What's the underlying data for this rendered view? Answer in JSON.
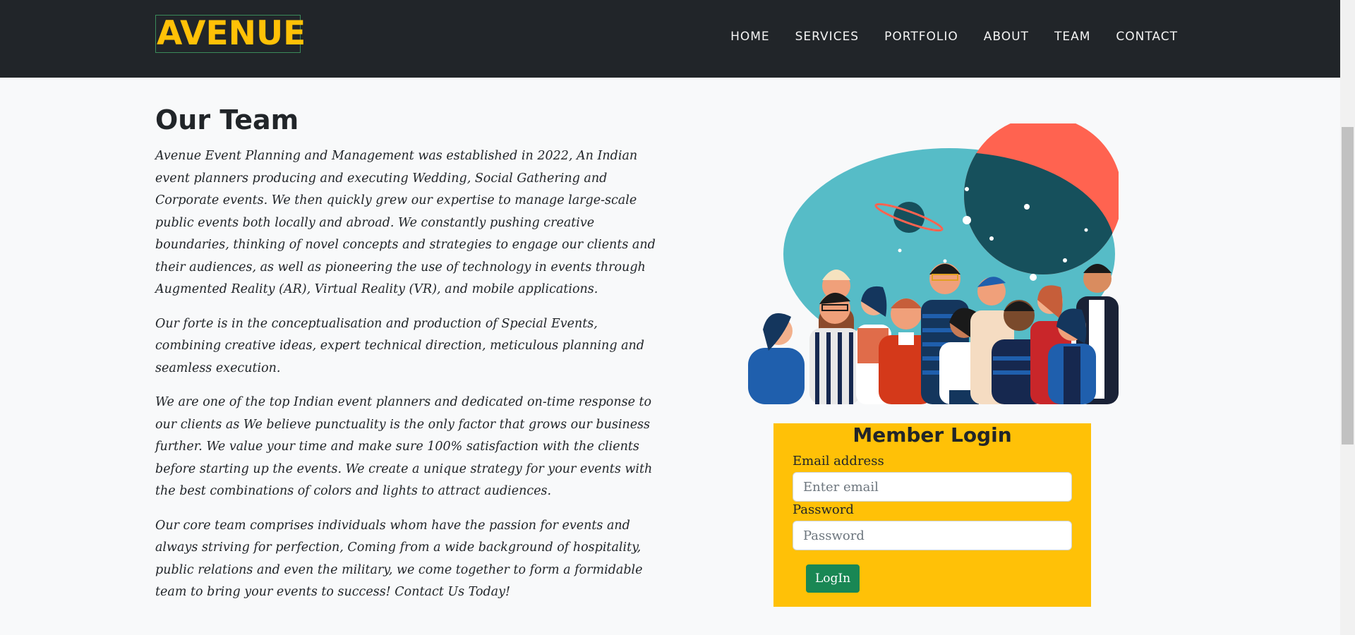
{
  "brand": {
    "name": "AVENUE"
  },
  "nav": {
    "items": [
      {
        "label": "HOME"
      },
      {
        "label": "SERVICES"
      },
      {
        "label": "PORTFOLIO"
      },
      {
        "label": "ABOUT"
      },
      {
        "label": "TEAM"
      },
      {
        "label": "CONTACT"
      }
    ]
  },
  "main": {
    "heading": "Our Team",
    "paragraphs": [
      "Avenue Event Planning and Management was established in 2022, An Indian event planners producing and executing Wedding, Social Gathering and Corporate events. We then quickly grew our expertise to manage large-scale public events both locally and abroad. We constantly pushing creative boundaries, thinking of novel concepts and strategies to engage our clients and their audiences, as well as pioneering the use of technology in events through Augmented Reality (AR), Virtual Reality (VR), and mobile applications.",
      "Our forte is in the conceptualisation and production of Special Events, combining creative ideas, expert technical direction, meticulous planning and seamless execution.",
      "We are one of the top Indian event planners and dedicated on-time response to our clients as We believe punctuality is the only factor that grows our business further. We value your time and make sure 100% satisfaction with the clients before starting up the events. We create a unique strategy for your events with the best combinations of colors and lights to attract audiences.",
      "Our core team comprises individuals whom have the passion for events and always striving for perfection, Coming from a wide background of hospitality, public relations and even the military, we come together to form a formidable team to bring your events to success! Contact Us Today!"
    ]
  },
  "illustration": {
    "icon": "team-illustration"
  },
  "login": {
    "title": "Member Login",
    "email_label": "Email address",
    "email_placeholder": "Enter email",
    "password_label": "Password",
    "password_placeholder": "Password",
    "button_label": "LogIn"
  },
  "colors": {
    "navbar": "#212529",
    "brand": "#ffc107",
    "login_bg": "#ffc107",
    "button": "#198754",
    "page_bg": "#f8f9fa"
  }
}
